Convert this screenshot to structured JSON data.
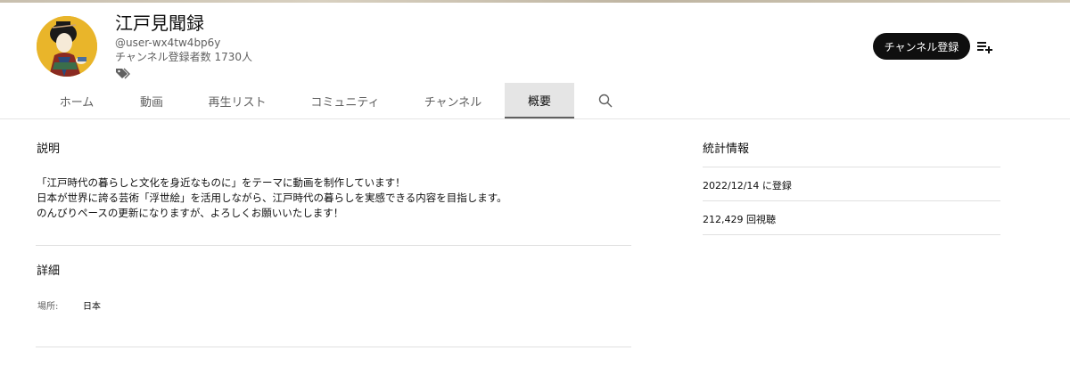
{
  "channel": {
    "title": "江戸見聞録",
    "handle": "@user-wx4tw4bp6y",
    "subscribers": "チャンネル登録者数 1730人"
  },
  "header": {
    "subscribe_label": "チャンネル登録"
  },
  "tabs": [
    {
      "label": "ホーム"
    },
    {
      "label": "動画"
    },
    {
      "label": "再生リスト"
    },
    {
      "label": "コミュニティ"
    },
    {
      "label": "チャンネル"
    },
    {
      "label": "概要",
      "active": true
    }
  ],
  "about": {
    "description_heading": "説明",
    "description_lines": [
      "「江戸時代の暮らしと文化を身近なものに」をテーマに動画を制作しています！",
      "日本が世界に誇る芸術「浮世絵」を活用しながら、江戸時代の暮らしを実感できる内容を目指します。",
      "のんびりペースの更新になりますが、よろしくお願いいたします！"
    ],
    "details_heading": "詳細",
    "location_label": "場所:",
    "location_value": "日本"
  },
  "stats": {
    "heading": "統計情報",
    "joined": "2022/12/14 に登録",
    "views": "212,429 回視聴"
  },
  "colors": {
    "accent": "#0f0f0f",
    "secondary_text": "#606060",
    "active_tab_bg": "#e5e5e5",
    "avatar_bg": "#e9b52a"
  },
  "icons": [
    "badge-icon",
    "playlist-add-icon",
    "search-icon"
  ]
}
